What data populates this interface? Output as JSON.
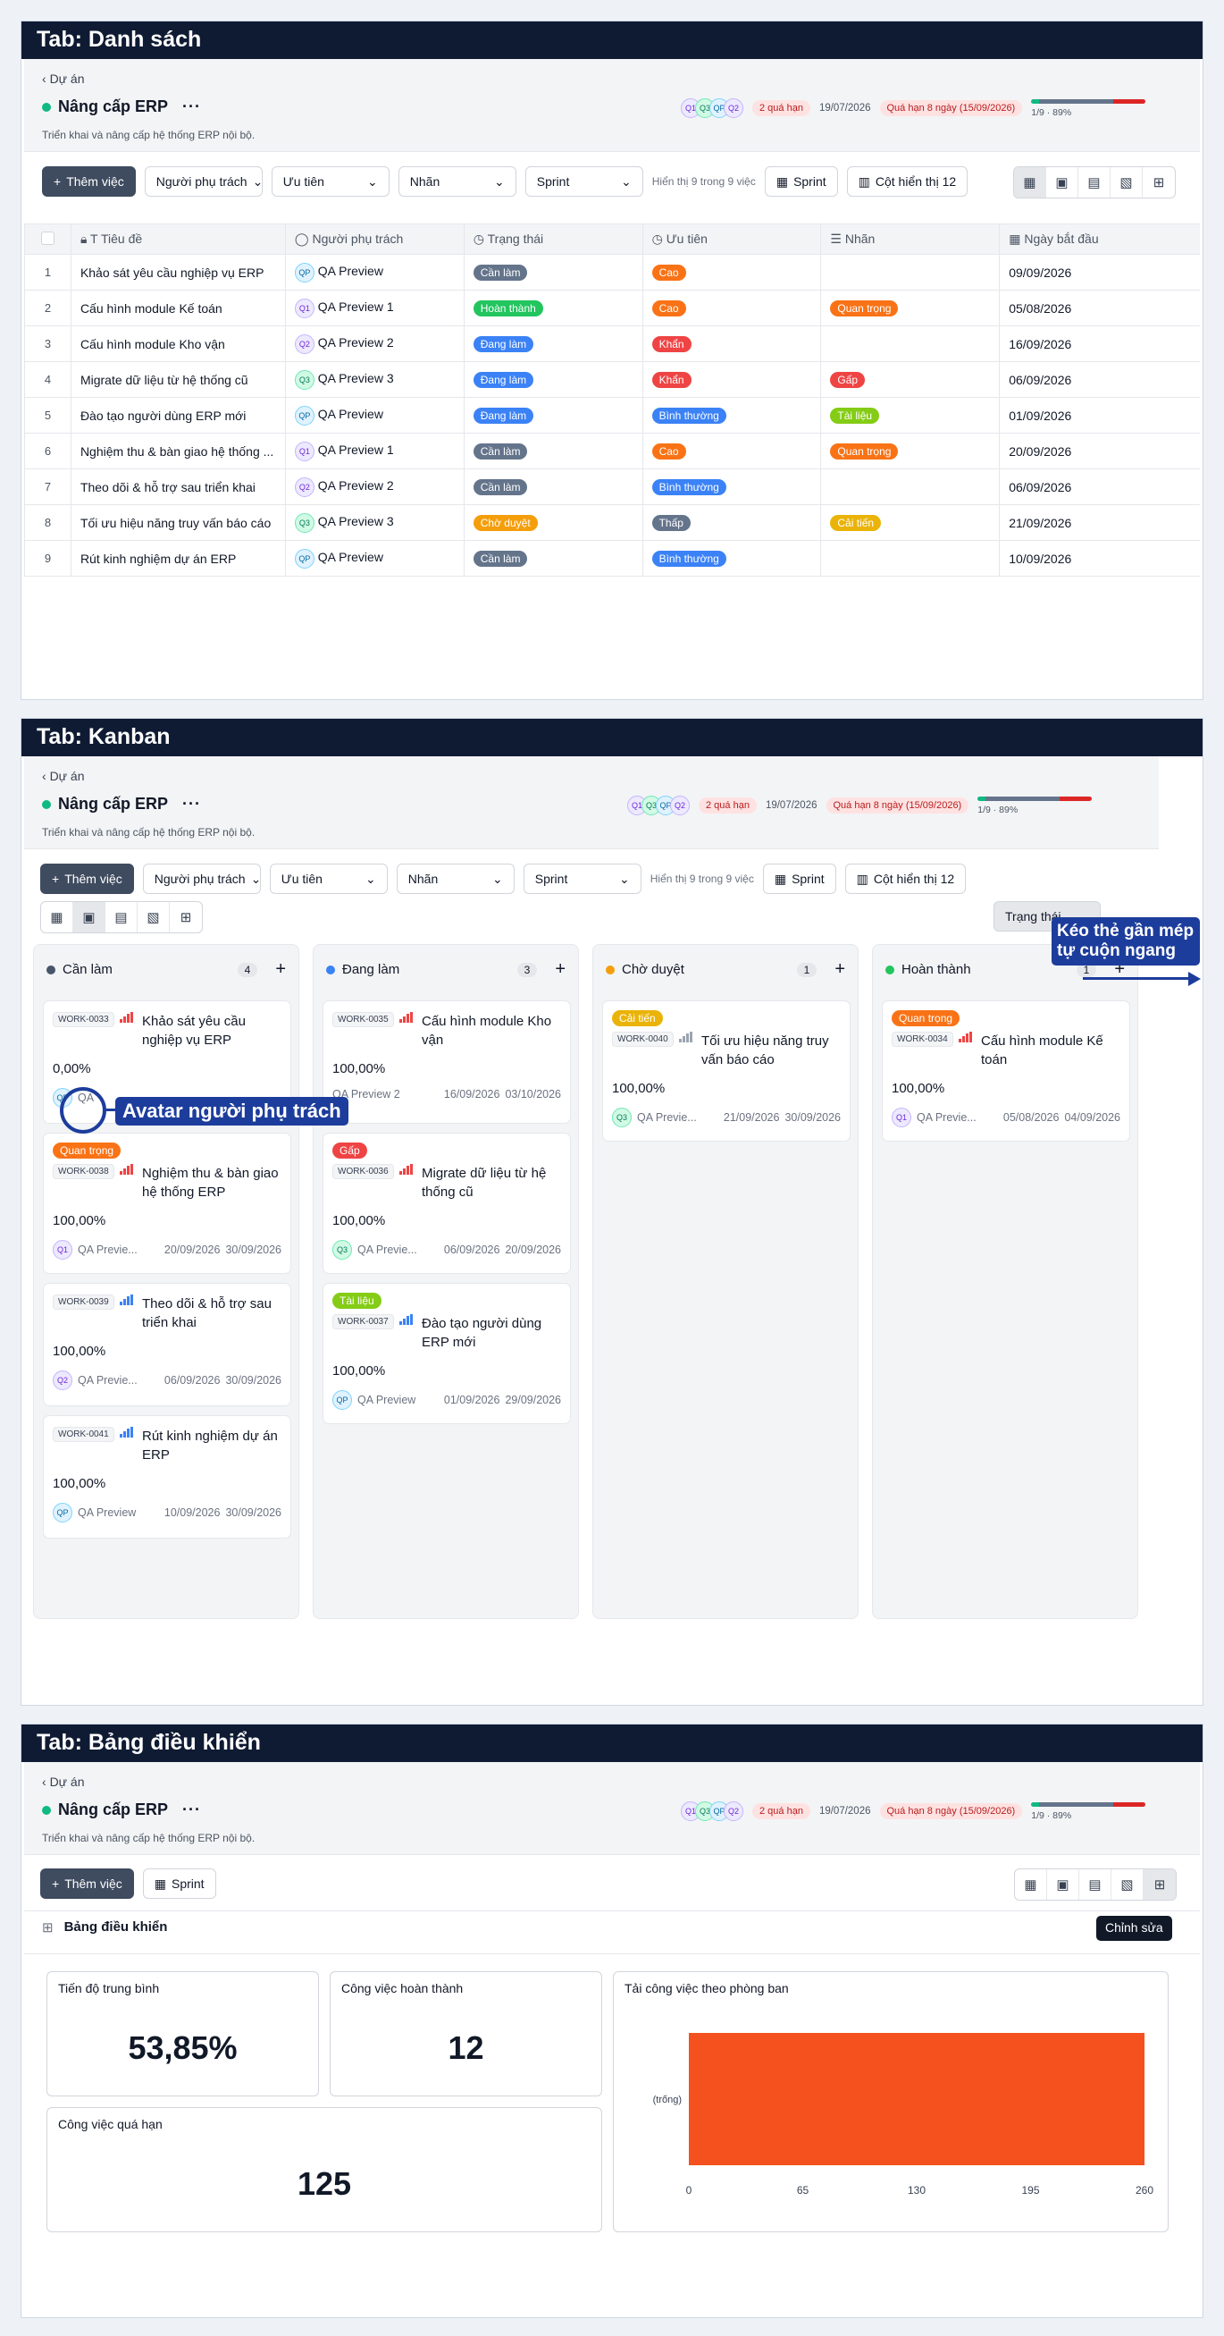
{
  "common": {
    "breadcrumb": "Dự án",
    "project_title": "Nâng cấp ERP",
    "more": "···",
    "description": "Triển khai và nâng cấp hệ thống ERP nội bộ.",
    "avatars": [
      "Q1",
      "Q3",
      "QP",
      "Q2"
    ],
    "overdue_count": "2 quá hạn",
    "date": "19/07/2026",
    "overdue_badge": "Quá hạn 8 ngày (15/09/2026)",
    "progress_text": "1/9 · 89%",
    "progress_value": 0.89,
    "add_task": "Thêm việc",
    "sprint": "Sprint",
    "filters": [
      "Người phụ trách",
      "Ưu tiên",
      "Nhãn",
      "Sprint"
    ],
    "showing": "Hiển thị 9 trong 9 việc",
    "columns_btn": "Cột hiển thị 12"
  },
  "list": {
    "tab_title": "Tab: Danh sách",
    "headers": [
      "Tiêu đề",
      "Người phụ trách",
      "Trạng thái",
      "Ưu tiên",
      "Nhãn",
      "Ngày bắt đầu"
    ],
    "rows": [
      {
        "n": "1",
        "title": "Khảo sát yêu cầu nghiệp vụ ERP",
        "av": "QP",
        "assignee": "QA Preview",
        "status": "Cần làm",
        "priority": "Cao",
        "label": "",
        "start": "09/09/2026"
      },
      {
        "n": "2",
        "title": "Cấu hình module Kế toán",
        "av": "Q1",
        "assignee": "QA Preview 1",
        "status": "Hoàn thành",
        "priority": "Cao",
        "label": "Quan trọng",
        "start": "05/08/2026"
      },
      {
        "n": "3",
        "title": "Cấu hình module Kho vận",
        "av": "Q2",
        "assignee": "QA Preview 2",
        "status": "Đang làm",
        "priority": "Khẩn",
        "label": "",
        "start": "16/09/2026"
      },
      {
        "n": "4",
        "title": "Migrate dữ liệu từ hệ thống cũ",
        "av": "Q3",
        "assignee": "QA Preview 3",
        "status": "Đang làm",
        "priority": "Khẩn",
        "label": "Gấp",
        "start": "06/09/2026"
      },
      {
        "n": "5",
        "title": "Đào tạo người dùng ERP mới",
        "av": "QP",
        "assignee": "QA Preview",
        "status": "Đang làm",
        "priority": "Bình thường",
        "label": "Tài liệu",
        "start": "01/09/2026"
      },
      {
        "n": "6",
        "title": "Nghiệm thu & bàn giao hệ thống ...",
        "av": "Q1",
        "assignee": "QA Preview 1",
        "status": "Cần làm",
        "priority": "Cao",
        "label": "Quan trọng",
        "start": "20/09/2026"
      },
      {
        "n": "7",
        "title": "Theo dõi & hỗ trợ sau triển khai",
        "av": "Q2",
        "assignee": "QA Preview 2",
        "status": "Cần làm",
        "priority": "Bình thường",
        "label": "",
        "start": "06/09/2026"
      },
      {
        "n": "8",
        "title": "Tối ưu hiệu năng truy vấn báo cáo",
        "av": "Q3",
        "assignee": "QA Preview 3",
        "status": "Chờ duyệt",
        "priority": "Thấp",
        "label": "Cải tiến",
        "start": "21/09/2026"
      },
      {
        "n": "9",
        "title": "Rút kinh nghiệm dự án ERP",
        "av": "QP",
        "assignee": "QA Preview",
        "status": "Cần làm",
        "priority": "Bình thường",
        "label": "",
        "start": "10/09/2026"
      }
    ]
  },
  "kanban": {
    "tab_title": "Tab: Kanban",
    "status_btn": "Trạng thái",
    "callout_avatar": "Avatar người phụ trách",
    "callout_drag": "Kéo thẻ gần mép tự cuộn ngang",
    "columns": [
      {
        "name": "Cần làm",
        "count": "4",
        "color": "#475569"
      },
      {
        "name": "Đang làm",
        "count": "3",
        "color": "#3b82f6"
      },
      {
        "name": "Chờ duyệt",
        "count": "1",
        "color": "#f59e0b"
      },
      {
        "name": "Hoàn thành",
        "count": "1",
        "color": "#22c55e"
      }
    ],
    "cards": [
      [
        {
          "label": "",
          "code": "WORK-0033",
          "title": "Khảo sát yêu cầu nghiệp vụ ERP",
          "pct": "0,00%",
          "av": "QP",
          "who": "QA",
          "d1": "",
          "d2": ""
        },
        {
          "label": "Quan trọng",
          "code": "WORK-0038",
          "title": "Nghiệm thu & bàn giao hệ thống ERP",
          "pct": "100,00%",
          "av": "Q1",
          "who": "QA Previe...",
          "d1": "20/09/2026",
          "d2": "30/09/2026"
        },
        {
          "label": "",
          "code": "WORK-0039",
          "title": "Theo dõi & hỗ trợ sau triển khai",
          "pct": "100,00%",
          "av": "Q2",
          "who": "QA Previe...",
          "d1": "06/09/2026",
          "d2": "30/09/2026"
        },
        {
          "label": "",
          "code": "WORK-0041",
          "title": "Rút kinh nghiệm dự án ERP",
          "pct": "100,00%",
          "av": "QP",
          "who": "QA Preview",
          "d1": "10/09/2026",
          "d2": "30/09/2026"
        }
      ],
      [
        {
          "label": "",
          "code": "WORK-0035",
          "title": "Cấu hình module Kho vận",
          "pct": "100,00%",
          "av": "",
          "who": "QA Preview 2",
          "d1": "16/09/2026",
          "d2": "03/10/2026"
        },
        {
          "label": "Gấp",
          "code": "WORK-0036",
          "title": "Migrate dữ liệu từ hệ thống cũ",
          "pct": "100,00%",
          "av": "Q3",
          "who": "QA Previe...",
          "d1": "06/09/2026",
          "d2": "20/09/2026"
        },
        {
          "label": "Tài liệu",
          "code": "WORK-0037",
          "title": "Đào tạo người dùng ERP mới",
          "pct": "100,00%",
          "av": "QP",
          "who": "QA Preview",
          "d1": "01/09/2026",
          "d2": "29/09/2026"
        }
      ],
      [
        {
          "label": "Cải tiến",
          "code": "WORK-0040",
          "title": "Tối ưu hiệu năng truy vấn báo cáo",
          "pct": "100,00%",
          "av": "Q3",
          "who": "QA Previe...",
          "d1": "21/09/2026",
          "d2": "30/09/2026"
        }
      ],
      [
        {
          "label": "Quan trọng",
          "code": "WORK-0034",
          "title": "Cấu hình module Kế toán",
          "pct": "100,00%",
          "av": "Q1",
          "who": "QA Previe...",
          "d1": "05/08/2026",
          "d2": "04/09/2026"
        }
      ]
    ]
  },
  "dashboard": {
    "tab_title": "Tab: Bảng điều khiển",
    "heading": "Bảng điều khiển",
    "edit": "Chỉnh sửa",
    "stats": [
      {
        "title": "Tiến độ trung bình",
        "value": "53,85%"
      },
      {
        "title": "Công việc hoàn thành",
        "value": "12"
      },
      {
        "title": "Công việc quá hạn",
        "value": "125"
      }
    ],
    "chart_title": "Tải công việc theo phòng ban"
  },
  "chart_data": {
    "type": "bar",
    "orientation": "horizontal",
    "categories": [
      "(trống)"
    ],
    "values": [
      260
    ],
    "xlim": [
      0,
      260
    ],
    "xticks": [
      "0",
      "65",
      "130",
      "195",
      "260"
    ],
    "title": "Tải công việc theo phòng ban",
    "color": "#f4511e"
  },
  "colors": {
    "Cần làm": "#64748b",
    "Hoàn thành": "#22c55e",
    "Đang làm": "#3b82f6",
    "Chờ duyệt": "#f59e0b",
    "Cao": "#f97316",
    "Khẩn": "#ef4444",
    "Bình thường": "#3b82f6",
    "Thấp": "#64748b",
    "Quan trọng": "#f97316",
    "Gấp": "#ef4444",
    "Tài liệu": "#84cc16",
    "Cải tiến": "#eab308"
  }
}
